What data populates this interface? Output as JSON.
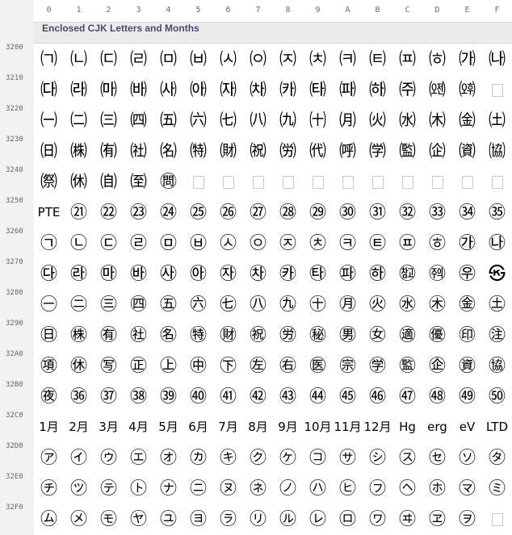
{
  "columns": [
    "0",
    "1",
    "2",
    "3",
    "4",
    "5",
    "6",
    "7",
    "8",
    "9",
    "A",
    "B",
    "C",
    "D",
    "E",
    "F"
  ],
  "block_title": "Enclosed CJK Letters and Months",
  "rows": [
    {
      "label": "3200",
      "cells": [
        "㈀",
        "㈁",
        "㈂",
        "㈃",
        "㈄",
        "㈅",
        "㈆",
        "㈇",
        "㈈",
        "㈉",
        "㈊",
        "㈋",
        "㈌",
        "㈍",
        "㈎",
        "㈏"
      ]
    },
    {
      "label": "3210",
      "cells": [
        "㈐",
        "㈑",
        "㈒",
        "㈓",
        "㈔",
        "㈕",
        "㈖",
        "㈗",
        "㈘",
        "㈙",
        "㈚",
        "㈛",
        "㈜",
        "㈝",
        "㈞",
        ""
      ]
    },
    {
      "label": "3220",
      "cells": [
        "㈠",
        "㈡",
        "㈢",
        "㈣",
        "㈤",
        "㈥",
        "㈦",
        "㈧",
        "㈨",
        "㈩",
        "㈪",
        "㈫",
        "㈬",
        "㈭",
        "㈮",
        "㈯"
      ]
    },
    {
      "label": "3230",
      "cells": [
        "㈰",
        "㈱",
        "㈲",
        "㈳",
        "㈴",
        "㈵",
        "㈶",
        "㈷",
        "㈸",
        "㈹",
        "㈺",
        "㈻",
        "㈼",
        "㈽",
        "㈾",
        "㈿"
      ]
    },
    {
      "label": "3240",
      "cells": [
        "㉀",
        "㉁",
        "㉂",
        "㉃",
        "㉄",
        "",
        "",
        "",
        "",
        "",
        "",
        "",
        "",
        "",
        "",
        ""
      ]
    },
    {
      "label": "3250",
      "cells": [
        "PTE",
        "㉑",
        "㉒",
        "㉓",
        "㉔",
        "㉕",
        "㉖",
        "㉗",
        "㉘",
        "㉙",
        "㉚",
        "㉛",
        "㉜",
        "㉝",
        "㉞",
        "㉟"
      ]
    },
    {
      "label": "3260",
      "cells": [
        "㉠",
        "㉡",
        "㉢",
        "㉣",
        "㉤",
        "㉥",
        "㉦",
        "㉧",
        "㉨",
        "㉩",
        "㉪",
        "㉫",
        "㉬",
        "㉭",
        "㉮",
        "㉯"
      ]
    },
    {
      "label": "3270",
      "cells": [
        "㉰",
        "㉱",
        "㉲",
        "㉳",
        "㉴",
        "㉵",
        "㉶",
        "㉷",
        "㉸",
        "㉹",
        "㉺",
        "㉻",
        "㉼",
        "㉽",
        "㉾",
        "㉿"
      ]
    },
    {
      "label": "3280",
      "cells": [
        "㊀",
        "㊁",
        "㊂",
        "㊃",
        "㊄",
        "㊅",
        "㊆",
        "㊇",
        "㊈",
        "㊉",
        "㊊",
        "㊋",
        "㊌",
        "㊍",
        "㊎",
        "㊏"
      ]
    },
    {
      "label": "3290",
      "cells": [
        "㊐",
        "㊑",
        "㊒",
        "㊓",
        "㊔",
        "㊕",
        "㊖",
        "㊗",
        "㊘",
        "㊙",
        "㊚",
        "㊛",
        "㊜",
        "㊝",
        "㊞",
        "㊟"
      ]
    },
    {
      "label": "32A0",
      "cells": [
        "㊠",
        "㊡",
        "㊢",
        "㊣",
        "㊤",
        "㊥",
        "㊦",
        "㊧",
        "㊨",
        "㊩",
        "㊪",
        "㊫",
        "㊬",
        "㊭",
        "㊮",
        "㊯"
      ]
    },
    {
      "label": "32B0",
      "cells": [
        "㊰",
        "㊱",
        "㊲",
        "㊳",
        "㊴",
        "㊵",
        "㊶",
        "㊷",
        "㊸",
        "㊹",
        "㊺",
        "㊻",
        "㊼",
        "㊽",
        "㊾",
        "㊿"
      ]
    },
    {
      "label": "32C0",
      "cells": [
        "1月",
        "2月",
        "3月",
        "4月",
        "5月",
        "6月",
        "7月",
        "8月",
        "9月",
        "10月",
        "11月",
        "12月",
        "Hg",
        "erg",
        "eV",
        "LTD"
      ]
    },
    {
      "label": "32D0",
      "cells": [
        "㋐",
        "㋑",
        "㋒",
        "㋓",
        "㋔",
        "㋕",
        "㋖",
        "㋗",
        "㋘",
        "㋙",
        "㋚",
        "㋛",
        "㋜",
        "㋝",
        "㋞",
        "㋟"
      ]
    },
    {
      "label": "32E0",
      "cells": [
        "㋠",
        "㋡",
        "㋢",
        "㋣",
        "㋤",
        "㋥",
        "㋦",
        "㋧",
        "㋨",
        "㋩",
        "㋪",
        "㋫",
        "㋬",
        "㋭",
        "㋮",
        "㋯"
      ]
    },
    {
      "label": "32F0",
      "cells": [
        "㋰",
        "㋱",
        "㋲",
        "㋳",
        "㋴",
        "㋵",
        "㋶",
        "㋷",
        "㋸",
        "㋹",
        "㋺",
        "㋻",
        "㋼",
        "㋽",
        "㋾",
        ""
      ]
    }
  ]
}
